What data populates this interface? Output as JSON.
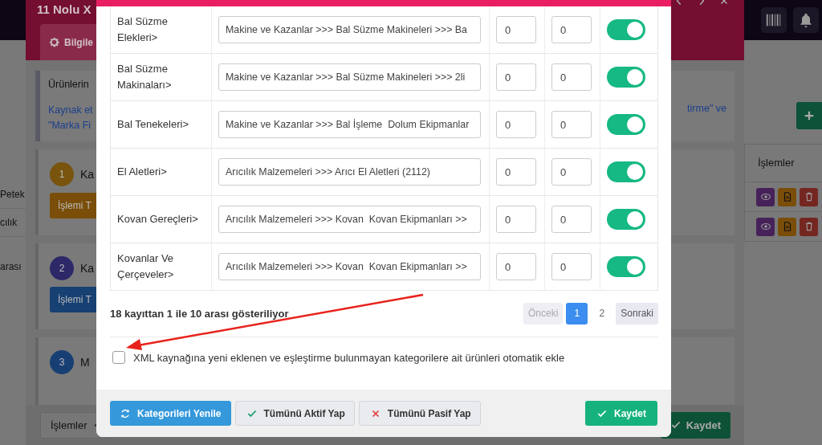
{
  "background": {
    "left_rows": [
      "Petek",
      "cılık"
    ],
    "left_info": "arası",
    "drawer": {
      "title": "11 Nolu X",
      "tab": "Bilgile",
      "info": {
        "heading": "Ürünlerin",
        "note_lines": [
          "Kaynak et",
          "\"Marka Fi"
        ],
        "note_right": "tirme\" ve"
      },
      "steps": [
        {
          "number": "1",
          "title": "Ka",
          "button": "İşlemi T",
          "color": "#78540d"
        },
        {
          "number": "2",
          "title": "Ka",
          "button": "İşlemi T",
          "color": "#2d2868"
        },
        {
          "number": "3",
          "title": "M",
          "color": "#183f73"
        }
      ],
      "footer": {
        "menu_button": "İşlemler",
        "save_button": "Kaydet"
      }
    },
    "table": {
      "header": "İşlemler",
      "rows": [
        {
          "actions": [
            {
              "kind": "view"
            },
            {
              "kind": "document"
            },
            {
              "kind": "delete"
            }
          ]
        },
        {
          "actions": [
            {
              "kind": "view"
            },
            {
              "kind": "document"
            },
            {
              "kind": "delete"
            }
          ]
        }
      ]
    }
  },
  "modal": {
    "rows": [
      {
        "category": "Bal Süzme Elekleri>",
        "mapping": "Makine ve Kazanlar >>> Bal Süzme Makineleri >>> Ba",
        "value_1": "0",
        "value_2": "0",
        "on": true
      },
      {
        "category": "Bal Süzme Makinaları>",
        "mapping": "Makine ve Kazanlar >>> Bal Süzme Makineleri >>> 2li",
        "value_1": "0",
        "value_2": "0",
        "on": true
      },
      {
        "category": "Bal Tenekeleri>",
        "mapping": "Makine ve Kazanlar >>> Bal İşleme  Dolum Ekipmanlar",
        "value_1": "0",
        "value_2": "0",
        "on": true
      },
      {
        "category": "El Aletleri>",
        "mapping": "Arıcılık Malzemeleri >>> Arıcı El Aletleri (2112)",
        "value_1": "0",
        "value_2": "0",
        "on": true
      },
      {
        "category": "Kovan Gereçleri>",
        "mapping": "Arıcılık Malzemeleri >>> Kovan  Kovan Ekipmanları >>",
        "value_1": "0",
        "value_2": "0",
        "on": true
      },
      {
        "category": "Kovanlar Ve Çerçeveler>",
        "mapping": "Arıcılık Malzemeleri >>> Kovan  Kovan Ekipmanları >>",
        "value_1": "0",
        "value_2": "0",
        "on": true
      }
    ],
    "summary": "18 kayıttan 1 ile 10 arası gösteriliyor",
    "pagination": {
      "previous": {
        "label": "Önceki",
        "disabled": true
      },
      "pages": [
        {
          "label": "1",
          "selected": true
        },
        {
          "label": "2",
          "selected": false
        }
      ],
      "next": {
        "label": "Sonraki",
        "disabled": false
      }
    },
    "auto_add": {
      "label": "XML kaynağına yeni eklenen ve eşleştirme bulunmayan kategorilere ait ürünleri otomatik ekle",
      "checked": false
    },
    "buttons": [
      {
        "label": "Kategorileri Yenile",
        "kind": "refresh"
      },
      {
        "label": "Tümünü Aktif Yap",
        "kind": "activate"
      },
      {
        "label": "Tümünü Pasif Yap",
        "kind": "deactivate"
      },
      {
        "label": "Kaydet",
        "kind": "save"
      }
    ]
  }
}
